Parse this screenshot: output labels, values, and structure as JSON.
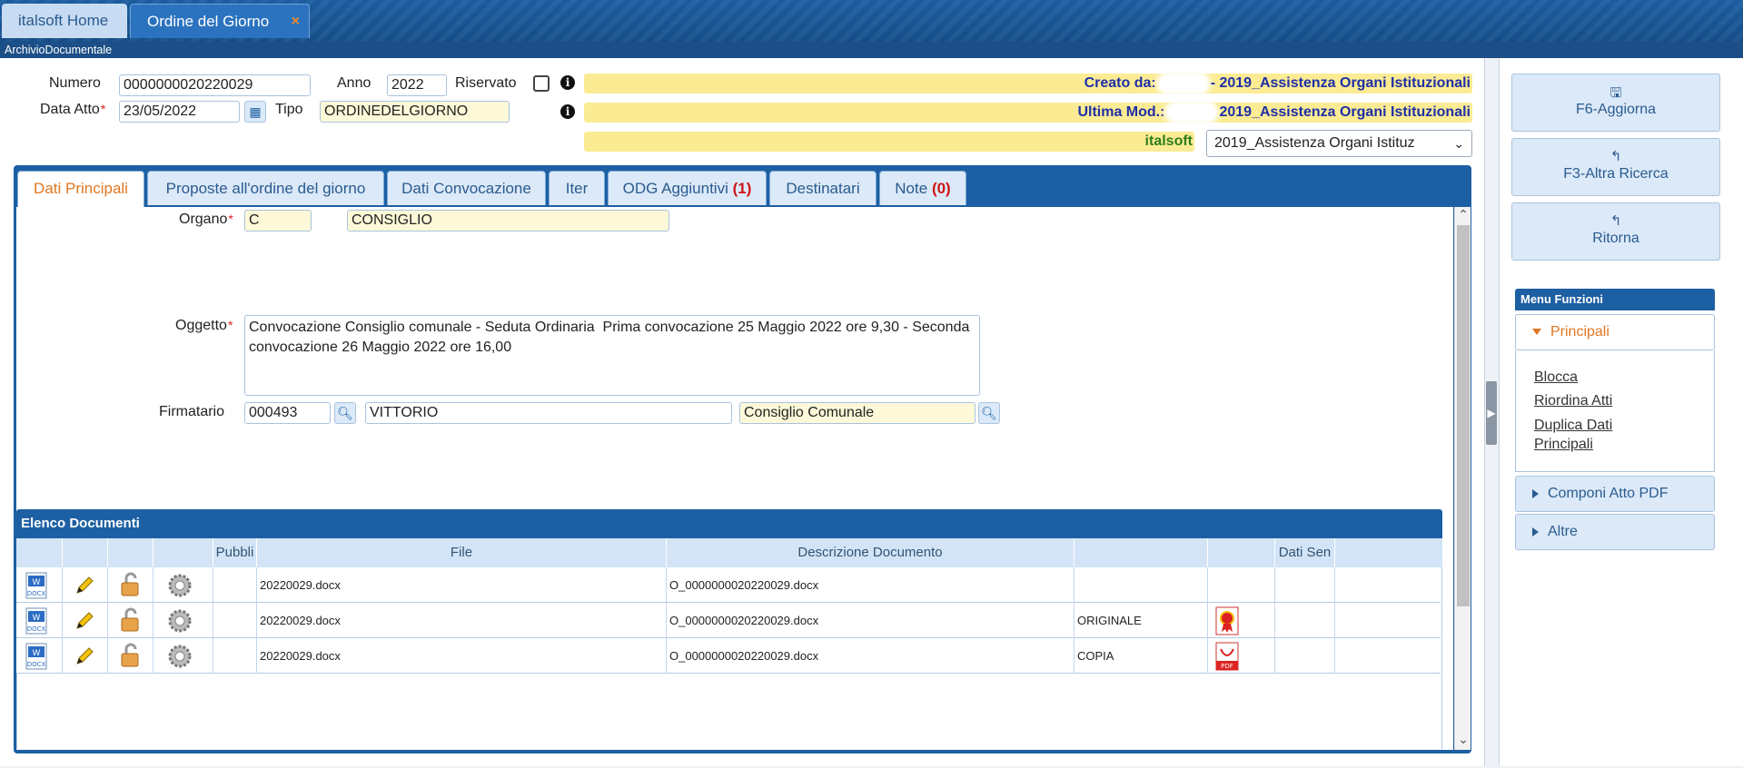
{
  "tabs": {
    "home": "italsoft Home",
    "current": "Ordine del Giorno",
    "close_glyph": "×"
  },
  "subtitle": "ArchivioDocumentale",
  "form": {
    "numero_label": "Numero",
    "numero_value": "0000000020220029",
    "anno_label": "Anno",
    "anno_value": "2022",
    "riservato_label": "Riservato",
    "data_atto_label": "Data Atto",
    "data_atto_value": "23/05/2022",
    "tipo_label": "Tipo",
    "tipo_value": "ORDINEDELGIORNO",
    "creato_da_label": "Creato da:",
    "creato_da_value": "- 2019_Assistenza Organi Istituzionali",
    "ultima_mod_label": "Ultima Mod.:",
    "ultima_mod_value": "2019_Assistenza Organi Istituzionali",
    "ente_banner": "italsoft",
    "ufficio_select": "2019_Assistenza Organi Istituz"
  },
  "inner_tabs": [
    {
      "label": "Dati Principali",
      "badge": ""
    },
    {
      "label": "Proposte all'ordine del giorno",
      "badge": ""
    },
    {
      "label": "Dati Convocazione",
      "badge": ""
    },
    {
      "label": "Iter",
      "badge": ""
    },
    {
      "label": "ODG Aggiuntivi",
      "badge": "(1)"
    },
    {
      "label": "Destinatari",
      "badge": ""
    },
    {
      "label": "Note",
      "badge": "(0)"
    }
  ],
  "dati": {
    "organo_label": "Organo",
    "organo_code": "C",
    "organo_desc": "CONSIGLIO",
    "oggetto_label": "Oggetto",
    "oggetto_value": "Convocazione Consiglio comunale - Seduta Ordinaria  Prima convocazione 25 Maggio 2022 ore 9,30 - Seconda convocazione 26 Maggio 2022 ore 16,00",
    "firmatario_label": "Firmatario",
    "firmatario_code": "000493",
    "firmatario_name": "VITTORIO",
    "firmatario_ente": "Consiglio Comunale"
  },
  "documents": {
    "title": "Elenco Documenti",
    "columns": [
      "",
      "",
      "",
      "",
      "Pubbli",
      "File",
      "Descrizione Documento",
      "",
      "",
      "Dati Sen",
      ""
    ],
    "rows": [
      {
        "file": "20220029.docx",
        "descrizione": "O_0000000020220029.docx",
        "tipo": "",
        "badge_icon": ""
      },
      {
        "file": "20220029.docx",
        "descrizione": "O_0000000020220029.docx",
        "tipo": "ORIGINALE",
        "badge_icon": "certificate-icon"
      },
      {
        "file": "20220029.docx",
        "descrizione": "O_0000000020220029.docx",
        "tipo": "COPIA",
        "badge_icon": "pdf-icon"
      }
    ]
  },
  "sidebar": {
    "buttons": [
      {
        "label": "F6-Aggiorna",
        "icon": "save-icon"
      },
      {
        "label": "F3-Altra Ricerca",
        "icon": "return-icon"
      },
      {
        "label": "Ritorna",
        "icon": "return-icon"
      }
    ],
    "menu_title": "Menu Funzioni",
    "sections": [
      {
        "label": "Principali",
        "open": true,
        "items": [
          "Blocca",
          "Riordina Atti",
          "Duplica Dati Principali"
        ]
      },
      {
        "label": "Componi Atto PDF",
        "open": false,
        "items": []
      },
      {
        "label": "Altre",
        "open": false,
        "items": []
      }
    ]
  },
  "colors": {
    "header_blue": "#1d5fa3",
    "active_orange": "#e07722",
    "banner_yellow": "#fbec94",
    "badge_red": "#d01515"
  }
}
